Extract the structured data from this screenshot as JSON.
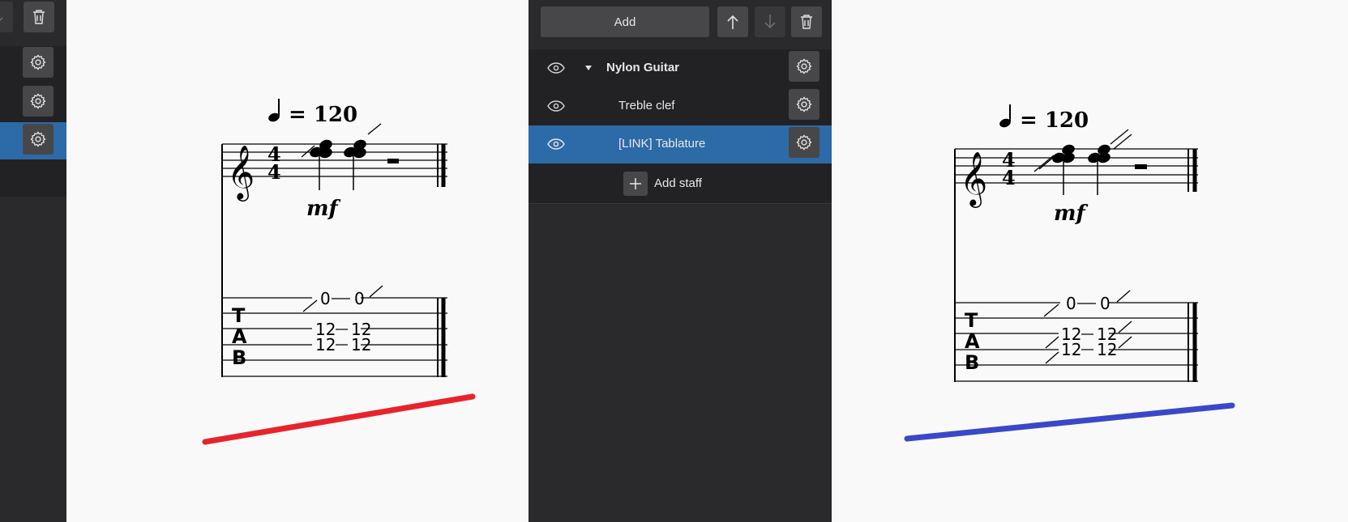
{
  "colors": {
    "panel_bg": "#2a2a2d",
    "panel_row_bg": "#222224",
    "button_bg": "#474749",
    "selected_row": "#2d6aa8",
    "score_bg": "#f9f9f9",
    "red_annotation": "#e8232b",
    "blue_annotation": "#3a48c8"
  },
  "left_panel": {
    "icons": [
      "arrow-down-icon",
      "trash-icon",
      "gear-icon",
      "gear-icon",
      "gear-icon"
    ]
  },
  "center_panel": {
    "toolbar": {
      "add_label": "Add",
      "move_up_icon": "arrow-up-icon",
      "move_down_icon": "arrow-down-icon",
      "delete_icon": "trash-icon"
    },
    "instrument": {
      "name": "Nylon Guitar",
      "expanded": true
    },
    "staves": [
      {
        "label": "Treble clef",
        "selected": false
      },
      {
        "label": "[LINK] Tablature",
        "selected": true
      }
    ],
    "add_staff_label": "Add staff"
  },
  "score_left": {
    "tempo": "= 120",
    "time_signature": {
      "top": "4",
      "bottom": "4"
    },
    "dynamic": "mf",
    "tab_clef": [
      "T",
      "A",
      "B"
    ],
    "tab_frets": {
      "string1": [
        "0",
        "0"
      ],
      "string3": [
        "12",
        "12"
      ],
      "string4": [
        "12",
        "12"
      ]
    }
  },
  "score_right": {
    "tempo": "= 120",
    "time_signature": {
      "top": "4",
      "bottom": "4"
    },
    "dynamic": "mf",
    "tab_clef": [
      "T",
      "A",
      "B"
    ],
    "tab_frets": {
      "string1": [
        "0",
        "0"
      ],
      "string3": [
        "12",
        "12"
      ],
      "string4": [
        "12",
        "12"
      ]
    }
  }
}
